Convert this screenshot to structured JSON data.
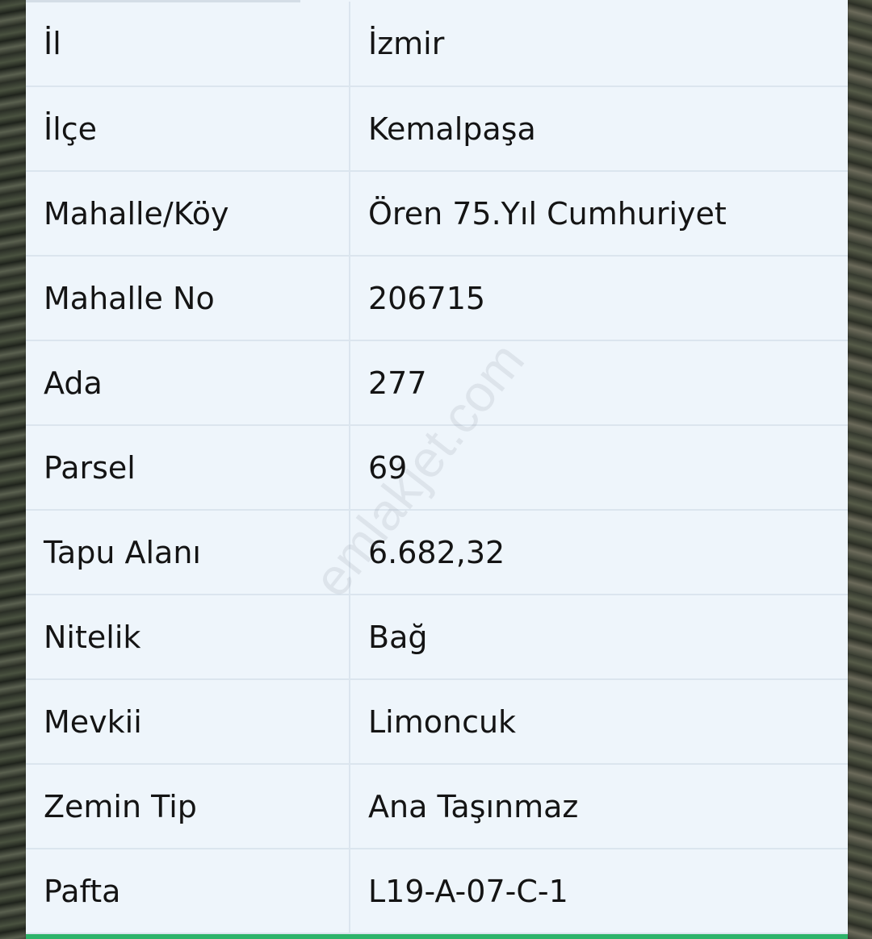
{
  "watermark": "emlakjet.com",
  "rows": [
    {
      "label": "İl",
      "value": "İzmir"
    },
    {
      "label": "İlçe",
      "value": "Kemalpaşa"
    },
    {
      "label": "Mahalle/Köy",
      "value": "Ören 75.Yıl Cumhuriyet"
    },
    {
      "label": "Mahalle No",
      "value": "206715"
    },
    {
      "label": "Ada",
      "value": "277"
    },
    {
      "label": "Parsel",
      "value": "69"
    },
    {
      "label": "Tapu Alanı",
      "value": "6.682,32"
    },
    {
      "label": "Nitelik",
      "value": "Bağ"
    },
    {
      "label": "Mevkii",
      "value": "Limoncuk"
    },
    {
      "label": "Zemin Tip",
      "value": "Ana Taşınmaz"
    },
    {
      "label": "Pafta",
      "value": "L19-A-07-C-1"
    }
  ],
  "colors": {
    "panel_background": "#eef5fb",
    "divider": "#dbe5ee",
    "accent_bar": "#2db36a"
  }
}
